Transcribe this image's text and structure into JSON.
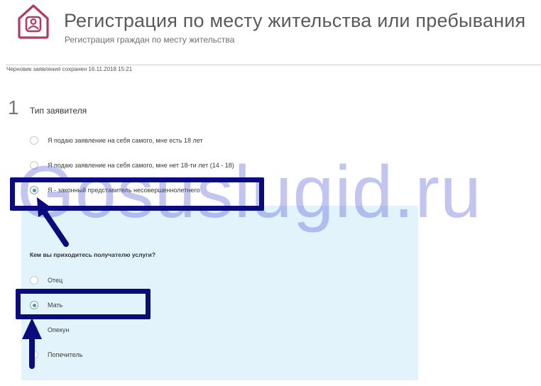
{
  "header": {
    "title": "Регистрация по месту жительства или пребывания",
    "subtitle": "Регистрация граждан по месту жительства",
    "icon": "house-person-icon",
    "icon_color": "#b23a63"
  },
  "draft_status": "Черновик заявления сохранен 16.11.2018 15:21",
  "step": {
    "number": "1",
    "title": "Тип заявителя",
    "options": [
      {
        "label": "Я подаю заявление на себя самого, мне есть 18 лет",
        "checked": false
      },
      {
        "label": "Я подаю заявление на себя самого, мне нет 18-ти лет (14 - 18)",
        "checked": false
      },
      {
        "label": "Я - законный представитель несовершеннолетнего",
        "checked": true
      }
    ]
  },
  "relation": {
    "question": "Кем вы приходитесь получателю услуги?",
    "options": [
      {
        "label": "Отец",
        "checked": false
      },
      {
        "label": "Мать",
        "checked": true
      },
      {
        "label": "Опекун",
        "checked": false
      },
      {
        "label": "Попечитель",
        "checked": false
      }
    ]
  },
  "watermark": "Gosuslugid.ru",
  "colors": {
    "accent": "#b23a63",
    "annotation": "#0b0b7e",
    "panel_bg": "#e3f3fc",
    "radio_checked": "#5a8f9b"
  }
}
